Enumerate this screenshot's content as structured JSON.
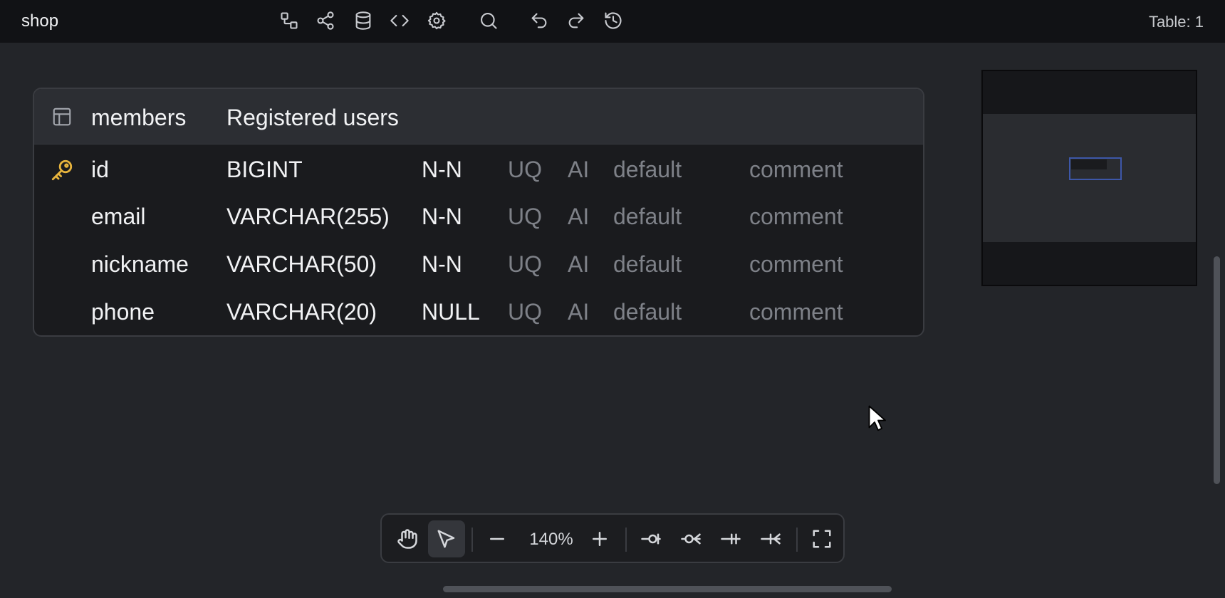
{
  "app": {
    "title": "shop",
    "table_count": "Table: 1"
  },
  "toolbar_icons": [
    "diagram-icon",
    "share-icon",
    "database-icon",
    "code-icon",
    "settings-icon",
    "search-icon",
    "undo-icon",
    "redo-icon",
    "history-icon"
  ],
  "table": {
    "name": "members",
    "comment": "Registered users",
    "columns": [
      {
        "name": "id",
        "type": "BIGINT",
        "nullable": "N-N",
        "uq": "UQ",
        "ai": "AI",
        "default": "default",
        "comment": "comment",
        "primary_key": true
      },
      {
        "name": "email",
        "type": "VARCHAR(255)",
        "nullable": "N-N",
        "uq": "UQ",
        "ai": "AI",
        "default": "default",
        "comment": "comment",
        "primary_key": false
      },
      {
        "name": "nickname",
        "type": "VARCHAR(50)",
        "nullable": "N-N",
        "uq": "UQ",
        "ai": "AI",
        "default": "default",
        "comment": "comment",
        "primary_key": false
      },
      {
        "name": "phone",
        "type": "VARCHAR(20)",
        "nullable": "NULL",
        "uq": "UQ",
        "ai": "AI",
        "default": "default",
        "comment": "comment",
        "primary_key": false
      }
    ]
  },
  "bottom_toolbar": {
    "zoom": "140%",
    "active_tool": "select"
  },
  "colors": {
    "background": "#232529",
    "topbar": "#111215",
    "key_icon": "#e7b43d",
    "minimap_viewport": "#3d57a8"
  }
}
